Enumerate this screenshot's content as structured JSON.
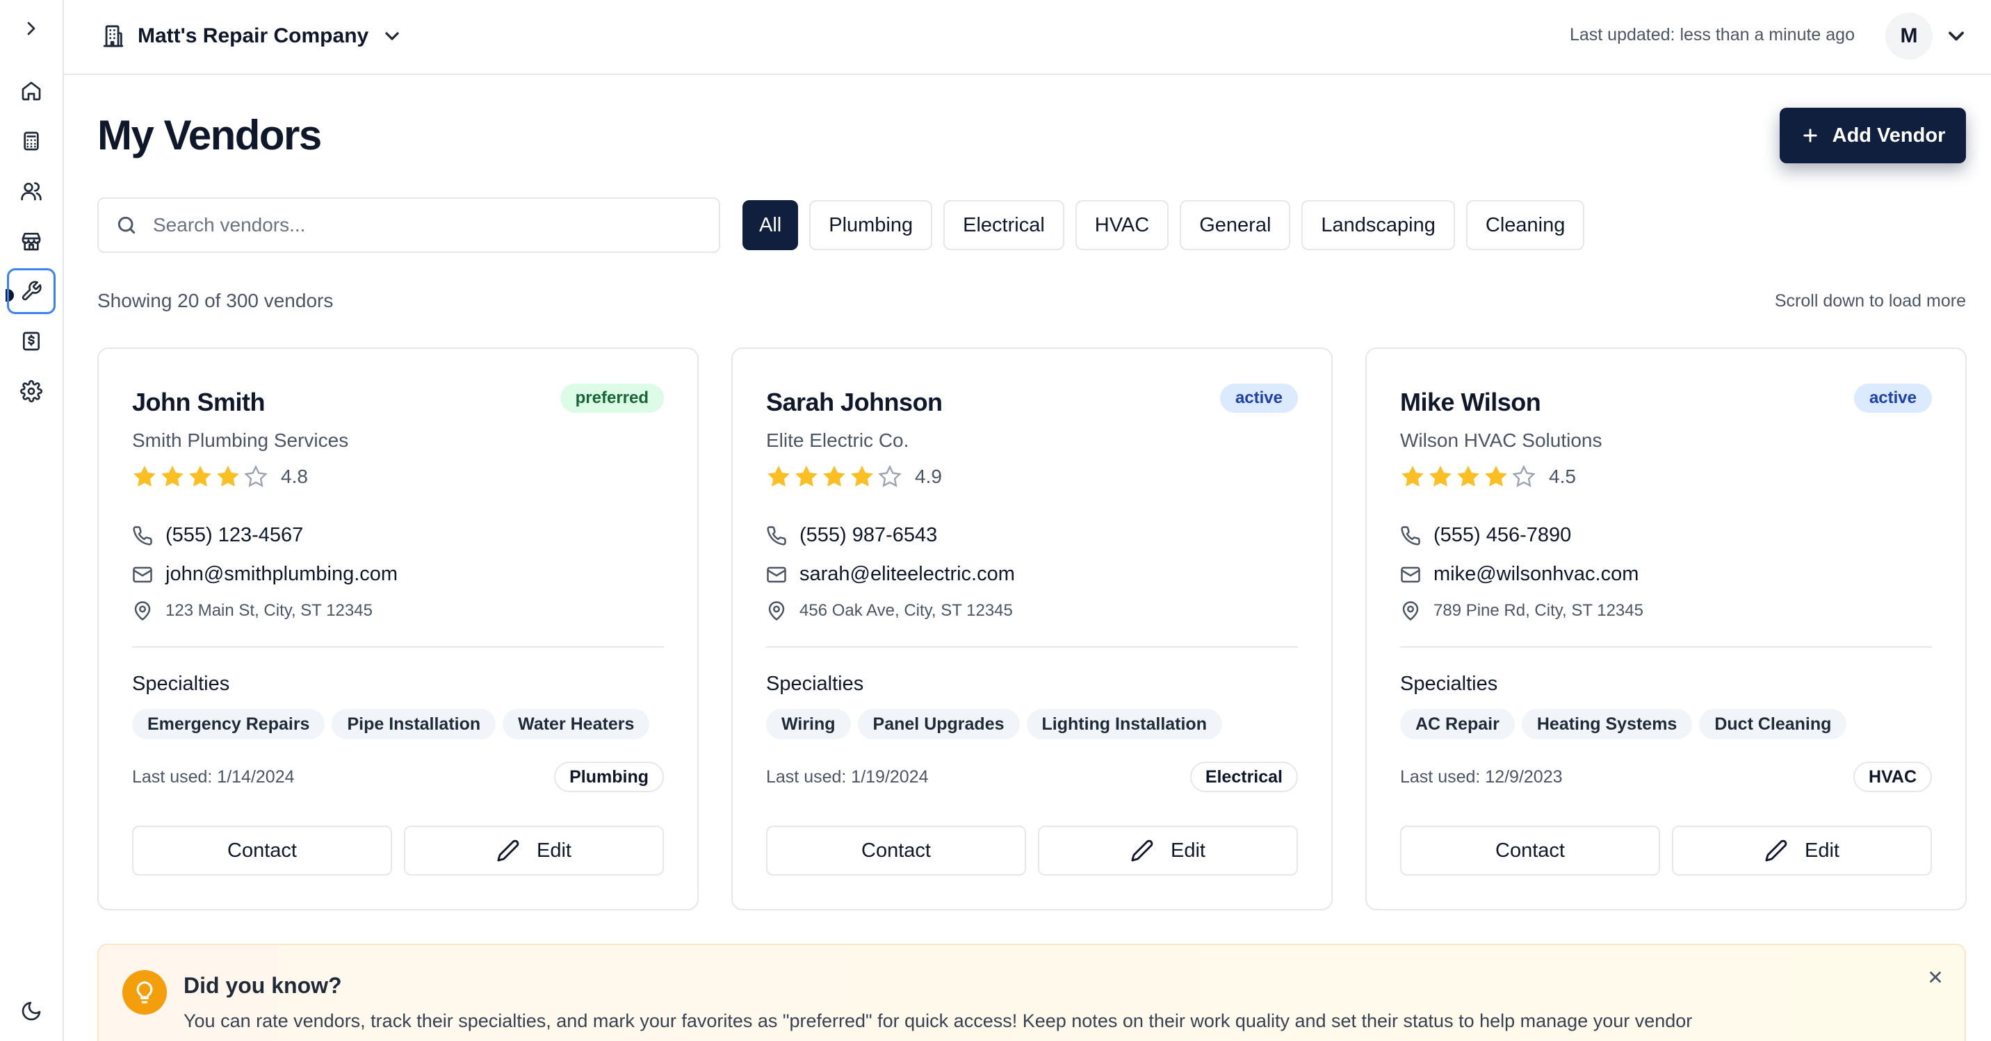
{
  "topbar": {
    "company_name": "Matt's Repair Company",
    "last_updated": "Last updated: less than a minute ago",
    "avatar_initial": "M"
  },
  "sidebar": {
    "items": [
      {
        "icon": "chevron-right-icon"
      },
      {
        "icon": "home-icon"
      },
      {
        "icon": "calculator-icon"
      },
      {
        "icon": "users-icon"
      },
      {
        "icon": "store-icon"
      },
      {
        "icon": "wrench-icon",
        "active": true
      },
      {
        "icon": "dollar-receipt-icon"
      },
      {
        "icon": "gear-icon"
      },
      {
        "icon": "moon-icon"
      }
    ]
  },
  "header": {
    "title": "My Vendors",
    "add_button_label": "Add Vendor"
  },
  "search": {
    "placeholder": "Search vendors...",
    "value": ""
  },
  "filters": [
    "All",
    "Plumbing",
    "Electrical",
    "HVAC",
    "General",
    "Landscaping",
    "Cleaning"
  ],
  "active_filter": "All",
  "summary": {
    "showing": "Showing 20 of 300 vendors",
    "scroll_hint": "Scroll down to load more"
  },
  "labels": {
    "specialties": "Specialties",
    "contact": "Contact",
    "edit": "Edit"
  },
  "vendors": [
    {
      "name": "John Smith",
      "status": "preferred",
      "company": "Smith Plumbing Services",
      "stars": 4,
      "rating": "4.8",
      "phone": "(555) 123-4567",
      "email": "john@smithplumbing.com",
      "address": "123 Main St, City, ST 12345",
      "specialties": [
        "Emergency Repairs",
        "Pipe Installation",
        "Water Heaters"
      ],
      "last_used": "Last used: 1/14/2024",
      "category": "Plumbing"
    },
    {
      "name": "Sarah Johnson",
      "status": "active",
      "company": "Elite Electric Co.",
      "stars": 4,
      "rating": "4.9",
      "phone": "(555) 987-6543",
      "email": "sarah@eliteelectric.com",
      "address": "456 Oak Ave, City, ST 12345",
      "specialties": [
        "Wiring",
        "Panel Upgrades",
        "Lighting Installation"
      ],
      "last_used": "Last used: 1/19/2024",
      "category": "Electrical"
    },
    {
      "name": "Mike Wilson",
      "status": "active",
      "company": "Wilson HVAC Solutions",
      "stars": 4,
      "rating": "4.5",
      "phone": "(555) 456-7890",
      "email": "mike@wilsonhvac.com",
      "address": "789 Pine Rd, City, ST 12345",
      "specialties": [
        "AC Repair",
        "Heating Systems",
        "Duct Cleaning"
      ],
      "last_used": "Last used: 12/9/2023",
      "category": "HVAC"
    }
  ],
  "tip": {
    "title": "Did you know?",
    "text": "You can rate vendors, track their specialties, and mark your favorites as \"preferred\" for quick access! Keep notes on their work quality and set their status to help manage your vendor"
  }
}
